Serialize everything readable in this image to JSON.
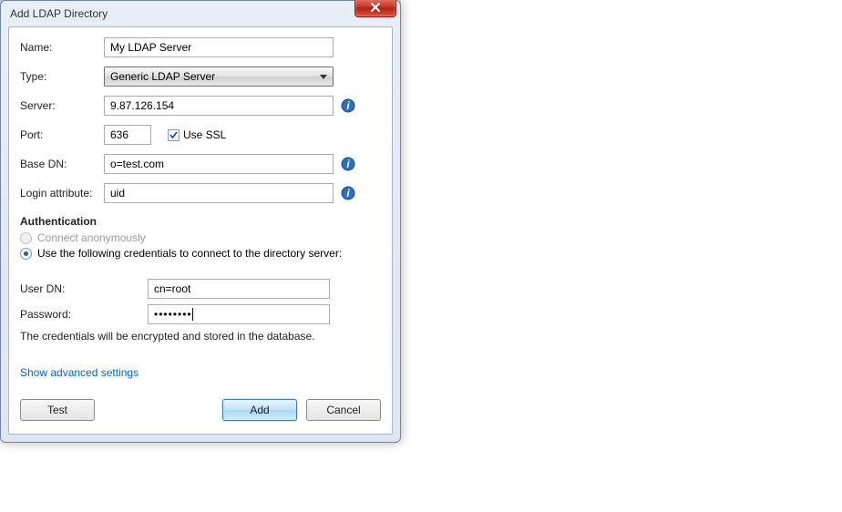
{
  "dialog": {
    "title": "Add LDAP Directory"
  },
  "fields": {
    "name_label": "Name:",
    "name_value": "My LDAP Server",
    "type_label": "Type:",
    "type_value": "Generic LDAP Server",
    "server_label": "Server:",
    "server_value": "9.87.126.154",
    "port_label": "Port:",
    "port_value": "636",
    "use_ssl_label": "Use SSL",
    "base_dn_label": "Base DN:",
    "base_dn_value": "o=test.com",
    "login_attr_label": "Login attribute:",
    "login_attr_value": "uid"
  },
  "auth": {
    "section_title": "Authentication",
    "anonymous_label": "Connect anonymously",
    "credentials_label": "Use the following credentials to connect to the directory server:",
    "user_dn_label": "User DN:",
    "user_dn_value": "cn=root",
    "password_label": "Password:",
    "password_value": "••••••••",
    "note": "The credentials will be encrypted and stored in the database."
  },
  "links": {
    "advanced": "Show advanced settings"
  },
  "buttons": {
    "test": "Test",
    "add": "Add",
    "cancel": "Cancel"
  }
}
